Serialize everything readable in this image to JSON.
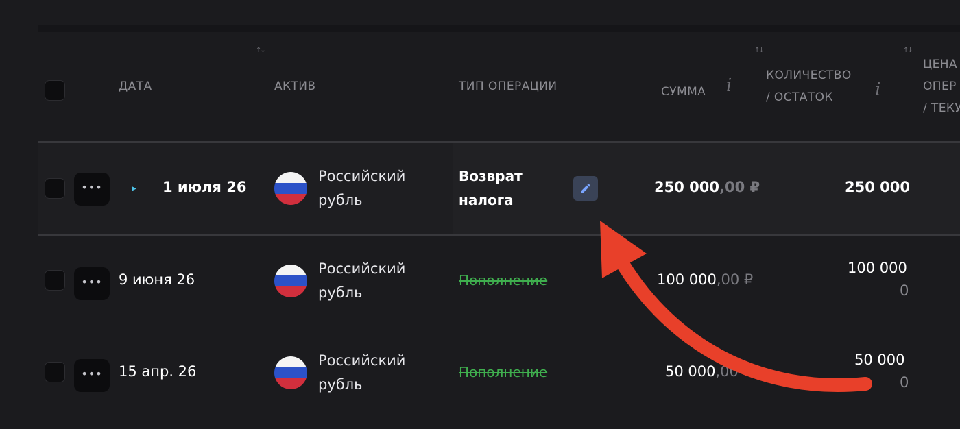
{
  "header": {
    "date": "ДАТА",
    "asset": "АКТИВ",
    "op_type": "ТИП ОПЕРАЦИИ",
    "sum": "СУММА",
    "qty_line1": "КОЛИЧЕСТВО",
    "qty_line2": "/ ОСТАТОК",
    "price_line1": "ЦЕНА",
    "price_line2": "ОПЕР",
    "price_line3": "/ ТЕКУ",
    "sort_glyph": "↑↓",
    "info_glyph": "i"
  },
  "more_label": "•••",
  "rows": [
    {
      "date": "1 июля 26",
      "asset_line1": "Российский",
      "asset_line2": "рубль",
      "op_line1": "Возврат",
      "op_line2": "налога",
      "sum_int": "250 000",
      "sum_dec": ",00 ₽",
      "qty": "250 000",
      "expanded_indicator": "▸"
    },
    {
      "date": "9 июня 26",
      "asset_line1": "Российский",
      "asset_line2": "рубль",
      "op": "Пополнение",
      "sum_int": "100 000",
      "sum_dec": ",00 ₽",
      "qty": "100 000",
      "remainder": "0"
    },
    {
      "date": "15 апр. 26",
      "asset_line1": "Российский",
      "asset_line2": "рубль",
      "op": "Пополнение",
      "sum_int": "50 000",
      "sum_dec": ",00 ₽",
      "qty": "50 000",
      "remainder": "0"
    }
  ],
  "colors": {
    "background": "#1b1b1e",
    "strike_green": "#3fae4e",
    "arrow_red": "#e8402a",
    "edit_bg": "#3a4357",
    "expand_cyan": "#4ec3e8"
  },
  "icons": [
    "sort-icon",
    "info-icon",
    "more-icon",
    "russia-flag-icon",
    "pencil-icon",
    "expand-caret-icon",
    "arrow-annotation"
  ]
}
